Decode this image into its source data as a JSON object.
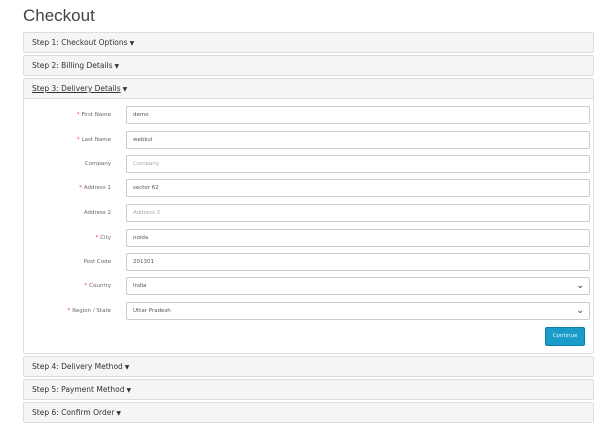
{
  "title": "Checkout",
  "steps": [
    {
      "label": "Step 1: Checkout Options"
    },
    {
      "label": "Step 2: Billing Details"
    },
    {
      "label": "Step 3: Delivery Details"
    },
    {
      "label": "Step 4: Delivery Method"
    },
    {
      "label": "Step 5: Payment Method"
    },
    {
      "label": "Step 6: Confirm Order"
    }
  ],
  "form": {
    "fields": [
      {
        "label": "First Name",
        "required": "*",
        "value": "demo",
        "placeholder": ""
      },
      {
        "label": "Last Name",
        "required": "*",
        "value": "webkul",
        "placeholder": ""
      },
      {
        "label": "Company",
        "value": "",
        "placeholder": "Company"
      },
      {
        "label": "Address 1",
        "required": "*",
        "value": "sector 62",
        "placeholder": ""
      },
      {
        "label": "Address 2",
        "value": "",
        "placeholder": "Address 2"
      },
      {
        "label": "City",
        "required": "*",
        "value": "noida",
        "placeholder": ""
      },
      {
        "label": "Post Code",
        "value": "201301",
        "placeholder": ""
      },
      {
        "label": "Country",
        "required": "*",
        "value": "India"
      },
      {
        "label": "Region / State",
        "required": "*",
        "value": "Uttar Pradesh"
      }
    ],
    "continue_label": "Continue"
  }
}
